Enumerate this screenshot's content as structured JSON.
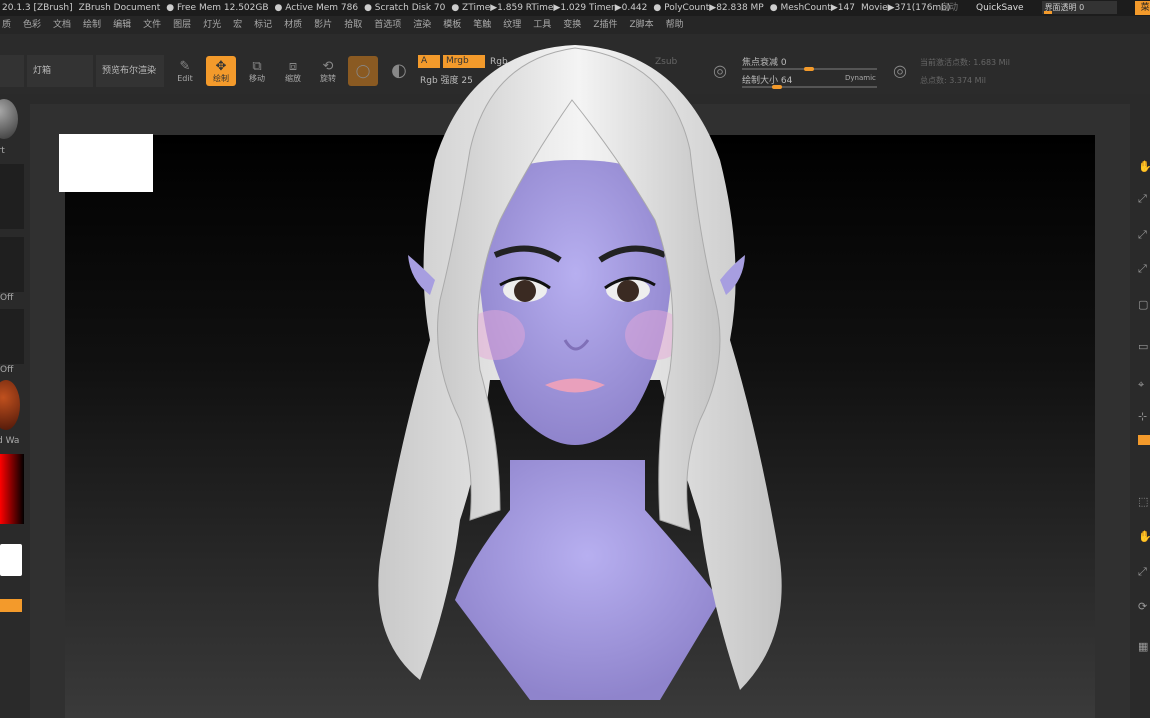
{
  "titlebar": {
    "items": [
      "20.1.3 [ZBrush]",
      "ZBrush Document",
      "● Free Mem 12.502GB",
      "● Active Mem 786",
      "● Scratch Disk 70",
      "● ZTime▶1.859 RTime▶1.029 Timer▶0.442",
      "● PolyCount▶82.838 MP",
      "● MeshCount▶147",
      "Movie▶371(176mb)"
    ],
    "auto": "自动",
    "quicksave": "QuickSave",
    "opacity": "界面透明 0",
    "menu": "菜单",
    "extra": "De"
  },
  "menubar": [
    "质",
    "色彩",
    "文档",
    "绘制",
    "编辑",
    "文件",
    "图层",
    "灯光",
    "宏",
    "标记",
    "材质",
    "影片",
    "拾取",
    "首选项",
    "渲染",
    "模板",
    "笔触",
    "纹理",
    "工具",
    "变换",
    "Z插件",
    "Z脚本",
    "帮助"
  ],
  "toolbar": {
    "light": "灯箱",
    "preview": "预览布尔渲染",
    "edit": "Edit",
    "draw": "绘制",
    "move": "移动",
    "scale": "缩放",
    "rotate": "旋转",
    "a": "A",
    "mrgb": "Mrgb",
    "rgb": "Rgb",
    "rgb_intensity": "Rgb 强度 25",
    "zsub": "Zsub",
    "focal": "焦点衰减 0",
    "draw_size": "绘制大小 64",
    "dynamic": "Dynamic",
    "active_points": "当前激活点数: 1.683 Mil",
    "total_points": "总点数: 3.374 Mil",
    "focal_value": 0.5,
    "draw_size_value": 0.25
  },
  "leftpanel": {
    "labels": [
      "art",
      "Off",
      "Off",
      "d Wa"
    ]
  },
  "colors": {
    "accent": "#f39a2b",
    "skin": "#a9a0e0",
    "hair": "#e8e8e8"
  }
}
